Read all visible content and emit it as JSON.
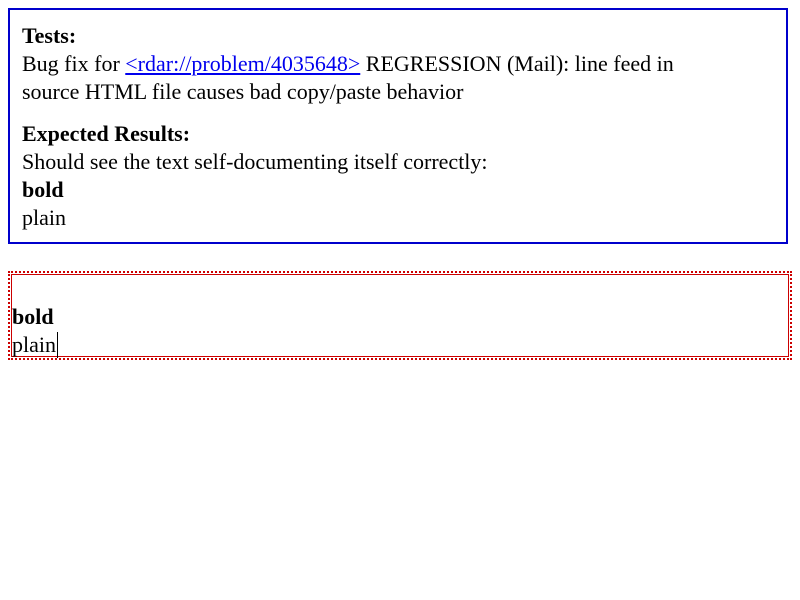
{
  "tests": {
    "heading": "Tests:",
    "prefix": "Bug fix for ",
    "link_text": "<rdar://problem/4035648>",
    "suffix_line1": " REGRESSION (Mail): line feed in",
    "line2": "source HTML file causes bad copy/paste behavior"
  },
  "expected": {
    "heading": "Expected Results:",
    "line": "Should see the text self-documenting itself correctly:",
    "bold_text": "bold",
    "plain_text": "plain"
  },
  "editor": {
    "bold_text": "bold",
    "plain_text": "plain"
  },
  "colors": {
    "info_border": "#0000cc",
    "edit_border": "#cc0000",
    "link": "#0000ee"
  }
}
